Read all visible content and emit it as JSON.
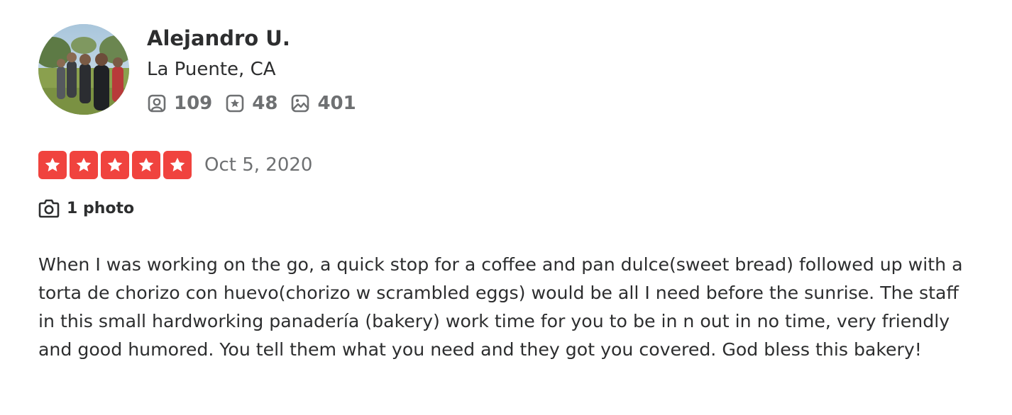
{
  "user": {
    "name": "Alejandro U.",
    "location": "La Puente, CA",
    "stats": {
      "friends": "109",
      "reviews": "48",
      "photos": "401"
    }
  },
  "review": {
    "rating": 5,
    "max_rating": 5,
    "date": "Oct 5, 2020",
    "photo_count_label": "1 photo",
    "text": "When I was working on the go, a quick stop for a coffee and pan dulce(sweet bread) followed up with a torta de chorizo con huevo(chorizo w scrambled eggs) would be all I need before the sunrise. The staff in this small hardworking panadería (bakery) work time for you to be in n out in no time, very friendly and good humored. You tell them what you need and they got you covered. God bless this bakery!"
  },
  "icons": {
    "friends": "friends-icon",
    "reviews": "review-star-icon",
    "photos": "photo-icon",
    "camera": "camera-icon",
    "star": "star-icon"
  },
  "colors": {
    "star_fill": "#f0433e",
    "text_primary": "#2d2e2f",
    "text_secondary": "#6e7072"
  }
}
